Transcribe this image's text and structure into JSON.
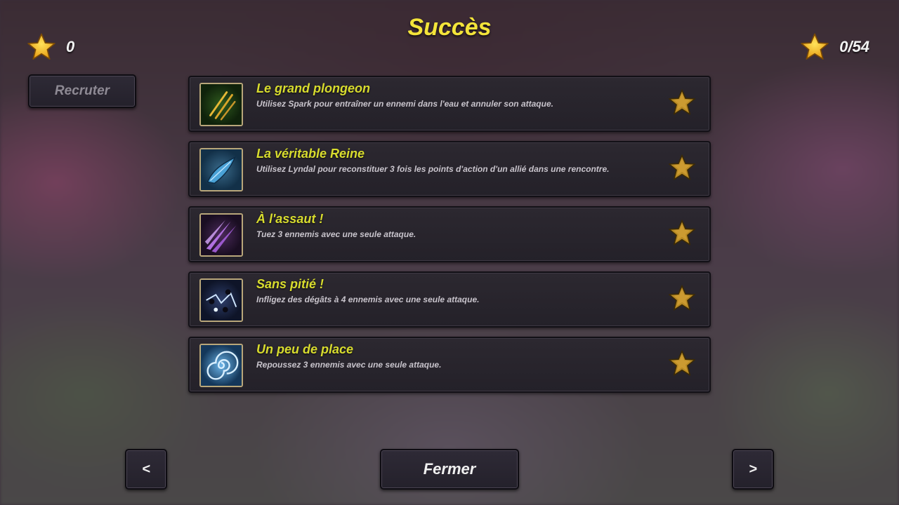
{
  "title": "Succès",
  "points": {
    "value": "0"
  },
  "progress": {
    "value": "0/54"
  },
  "buttons": {
    "recruit": "Recruter",
    "prev": "<",
    "next": ">",
    "close": "Fermer"
  },
  "achievements": [
    {
      "title": "Le grand plongeon",
      "description": "Utilisez Spark pour entraîner un ennemi dans l'eau et annuler son attaque.",
      "icon": "claw-slash-icon",
      "completed": false
    },
    {
      "title": "La véritable Reine",
      "description": "Utilisez Lyndal pour reconstituer 3 fois les points d'action d'un allié dans une rencontre.",
      "icon": "blue-feather-icon",
      "completed": false
    },
    {
      "title": "À l'assaut !",
      "description": "Tuez 3 ennemis avec une seule attaque.",
      "icon": "purple-spikes-icon",
      "completed": false
    },
    {
      "title": "Sans pitié !",
      "description": "Infligez des dégâts à 4 ennemis avec une seule attaque.",
      "icon": "lightning-figures-icon",
      "completed": false
    },
    {
      "title": "Un peu de place",
      "description": "Repoussez 3 ennemis avec une seule attaque.",
      "icon": "vortex-icon",
      "completed": false
    }
  ],
  "colors": {
    "title": "#f3e43a",
    "achievement_title": "#d8dc2e",
    "star_gold": "#e9b52a",
    "star_dim": "#8a6a1c"
  }
}
